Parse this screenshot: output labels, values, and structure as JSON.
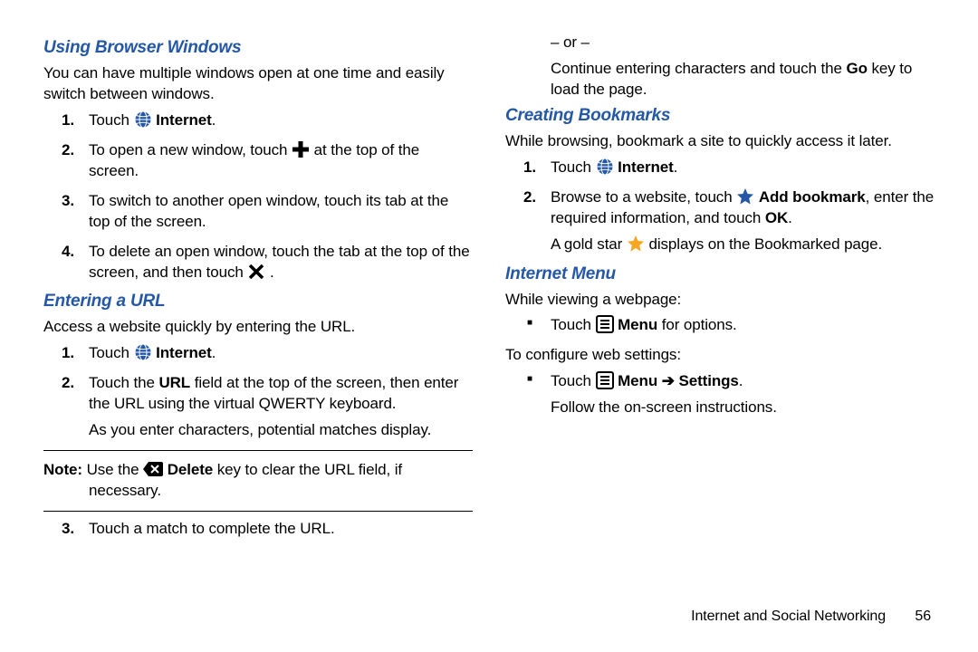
{
  "footer": {
    "chapter": "Internet and Social Networking",
    "page": "56"
  },
  "left": {
    "h1": "Using Browser Windows",
    "p1": "You can have multiple windows open at one time and easily switch between windows.",
    "s1": {
      "n": "1.",
      "a": "Touch ",
      "b": "Internet",
      "c": "."
    },
    "s2": {
      "n": "2.",
      "a": "To open a new window, touch ",
      "b": " at the top of the screen."
    },
    "s3": {
      "n": "3.",
      "a": "To switch to another open window, touch its tab at the top of the screen."
    },
    "s4": {
      "n": "4.",
      "a": "To delete an open window, touch the tab at the top of the screen, and then touch ",
      "b": " ."
    },
    "h2": "Entering a URL",
    "p2": "Access a website quickly by entering the URL.",
    "e1": {
      "n": "1.",
      "a": "Touch ",
      "b": "Internet",
      "c": "."
    },
    "e2": {
      "n": "2.",
      "a": "Touch the ",
      "b": "URL",
      "c": " field at the top of the screen, then enter the URL using the virtual QWERTY keyboard."
    },
    "e2b": "As you enter characters, potential matches display.",
    "note": {
      "a": "Note:",
      "b": " Use the ",
      "c": "Delete",
      "d": " key to clear the URL field, if necessary."
    }
  },
  "right": {
    "r3": {
      "n": "3.",
      "a": "Touch a match to complete the URL."
    },
    "or": "– or –",
    "r3b": {
      "a": "Continue entering characters and touch the ",
      "b": "Go",
      "c": " key to load the page."
    },
    "h3": "Creating Bookmarks",
    "p3": "While browsing, bookmark a site to quickly access it later.",
    "b1": {
      "n": "1.",
      "a": "Touch ",
      "b": "Internet",
      "c": "."
    },
    "b2": {
      "n": "2.",
      "a": "Browse to a website, touch ",
      "b": "Add bookmark",
      "c": ", enter the required information, and touch ",
      "d": "OK",
      "e": "."
    },
    "b2b": {
      "a": "A gold star ",
      "b": " displays on the Bookmarked page."
    },
    "h4": "Internet Menu",
    "p4": "While viewing a webpage:",
    "m1": {
      "a": "Touch ",
      "b": "Menu",
      "c": " for options."
    },
    "p5": "To configure web settings:",
    "m2": {
      "a": "Touch ",
      "b": "Menu",
      "c": "Settings",
      "d": "."
    },
    "m2b": "Follow the on-screen instructions."
  }
}
